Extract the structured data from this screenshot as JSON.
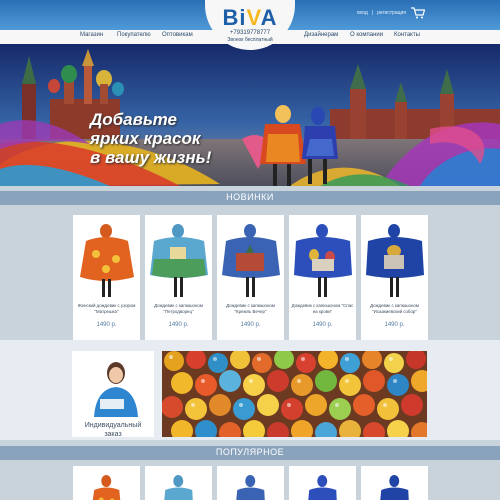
{
  "header": {
    "auth": {
      "login": "вход",
      "separator": "|",
      "register": "регистрация"
    },
    "logo": {
      "part1": "Bi",
      "part2": "V",
      "part3": "A"
    },
    "phone": "+79319778777",
    "phone_note": "Звонок бесплатный",
    "nav_left": [
      "Магазин",
      "Покупателю",
      "Оптовикам"
    ],
    "nav_right": [
      "Дизайнерам",
      "О компании",
      "Контакты"
    ],
    "icons": {
      "cart": "cart-icon"
    }
  },
  "banner": {
    "line1": "Добавьте",
    "line2": "ярких красок",
    "line3": "в вашу жизнь!"
  },
  "sections": {
    "new": "НОВИНКИ",
    "popular": "ПОПУЛЯРНОЕ"
  },
  "products": [
    {
      "name": "Женский дождевик с узором \"Матрешка\"",
      "price": "1490 р.",
      "color": "#e2621f"
    },
    {
      "name": "Дождевик с капюшоном \"Петродворец\"",
      "price": "1490 р.",
      "color": "#5aa7cf"
    },
    {
      "name": "Дождевик с капюшоном \"Кремль Вечер\"",
      "price": "1490 р.",
      "color": "#3a63b3"
    },
    {
      "name": "Дождевик с капюшоном \"Спас на крови\"",
      "price": "1490 р.",
      "color": "#2c4fbb"
    },
    {
      "name": "Дождевик с капюшоном \"Исаакиевский собор\"",
      "price": "1490 р.",
      "color": "#1f44a5"
    }
  ],
  "custom_order": {
    "line1": "Индивидуальный",
    "line2": "заказ"
  },
  "colors": {
    "header_blue": "#2a6fb5",
    "logo_blue": "#1f5fa7",
    "logo_yellow": "#f6b821",
    "section_bar": "#8aa3bc",
    "price": "#5377a0"
  }
}
